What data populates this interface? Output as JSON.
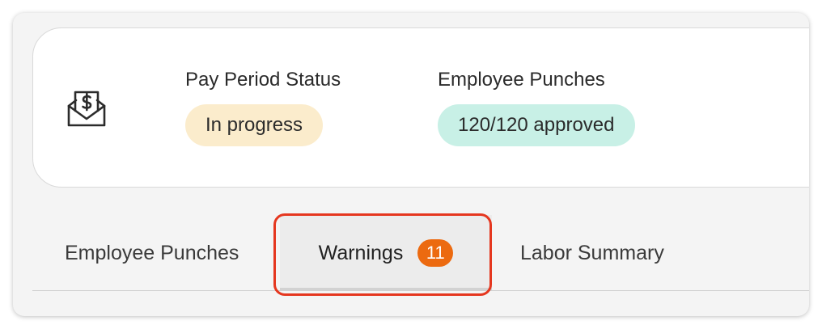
{
  "summary": {
    "pay_period": {
      "label": "Pay Period Status",
      "status": "In progress"
    },
    "punches": {
      "label": "Employee Punches",
      "status": "120/120 approved"
    },
    "icon": "envelope-dollar-icon"
  },
  "tabs": {
    "employee_punches": "Employee Punches",
    "warnings": "Warnings",
    "warnings_count": "11",
    "labor_summary": "Labor Summary",
    "active": "warnings"
  },
  "colors": {
    "progress_badge": "#fbeccc",
    "approved_badge": "#c8f0e6",
    "count_badge": "#ec6a10",
    "highlight": "#e5371f"
  }
}
